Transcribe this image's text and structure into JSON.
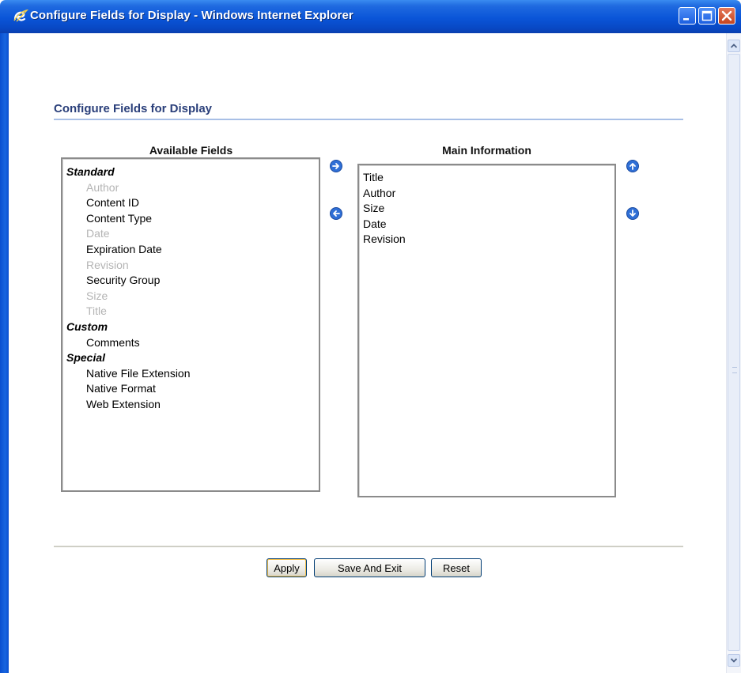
{
  "window": {
    "title": "Configure Fields for Display - Windows Internet Explorer",
    "icon": "ie-logo-icon",
    "controls": [
      "minimize-icon",
      "maximize-icon",
      "close-icon"
    ]
  },
  "page": {
    "title": "Configure Fields for Display"
  },
  "available_fields": {
    "heading": "Available Fields",
    "groups": [
      {
        "label": "Standard",
        "options": [
          {
            "label": "Author",
            "disabled": true
          },
          {
            "label": "Content ID",
            "disabled": false
          },
          {
            "label": "Content Type",
            "disabled": false
          },
          {
            "label": "Date",
            "disabled": true
          },
          {
            "label": "Expiration Date",
            "disabled": false
          },
          {
            "label": "Revision",
            "disabled": true
          },
          {
            "label": "Security Group",
            "disabled": false
          },
          {
            "label": "Size",
            "disabled": true
          },
          {
            "label": "Title",
            "disabled": true
          }
        ]
      },
      {
        "label": "Custom",
        "options": [
          {
            "label": "Comments",
            "disabled": false
          }
        ]
      },
      {
        "label": "Special",
        "options": [
          {
            "label": "Native File Extension",
            "disabled": false
          },
          {
            "label": "Native Format",
            "disabled": false
          },
          {
            "label": "Web Extension",
            "disabled": false
          }
        ]
      }
    ]
  },
  "main_information": {
    "heading": "Main Information",
    "items": [
      "Title",
      "Author",
      "Size",
      "Date",
      "Revision"
    ]
  },
  "move_buttons": {
    "add": "arrow-right-icon",
    "remove": "arrow-left-icon",
    "up": "arrow-up-icon",
    "down": "arrow-down-icon"
  },
  "buttons": {
    "apply": "Apply",
    "save_and_exit": "Save And Exit",
    "reset": "Reset"
  },
  "colors": {
    "titlebar": "#0a55d8",
    "page_title": "#2a3f7a",
    "disabled_option": "#b4b4b4",
    "arrow_button": "#2f6fd6"
  }
}
